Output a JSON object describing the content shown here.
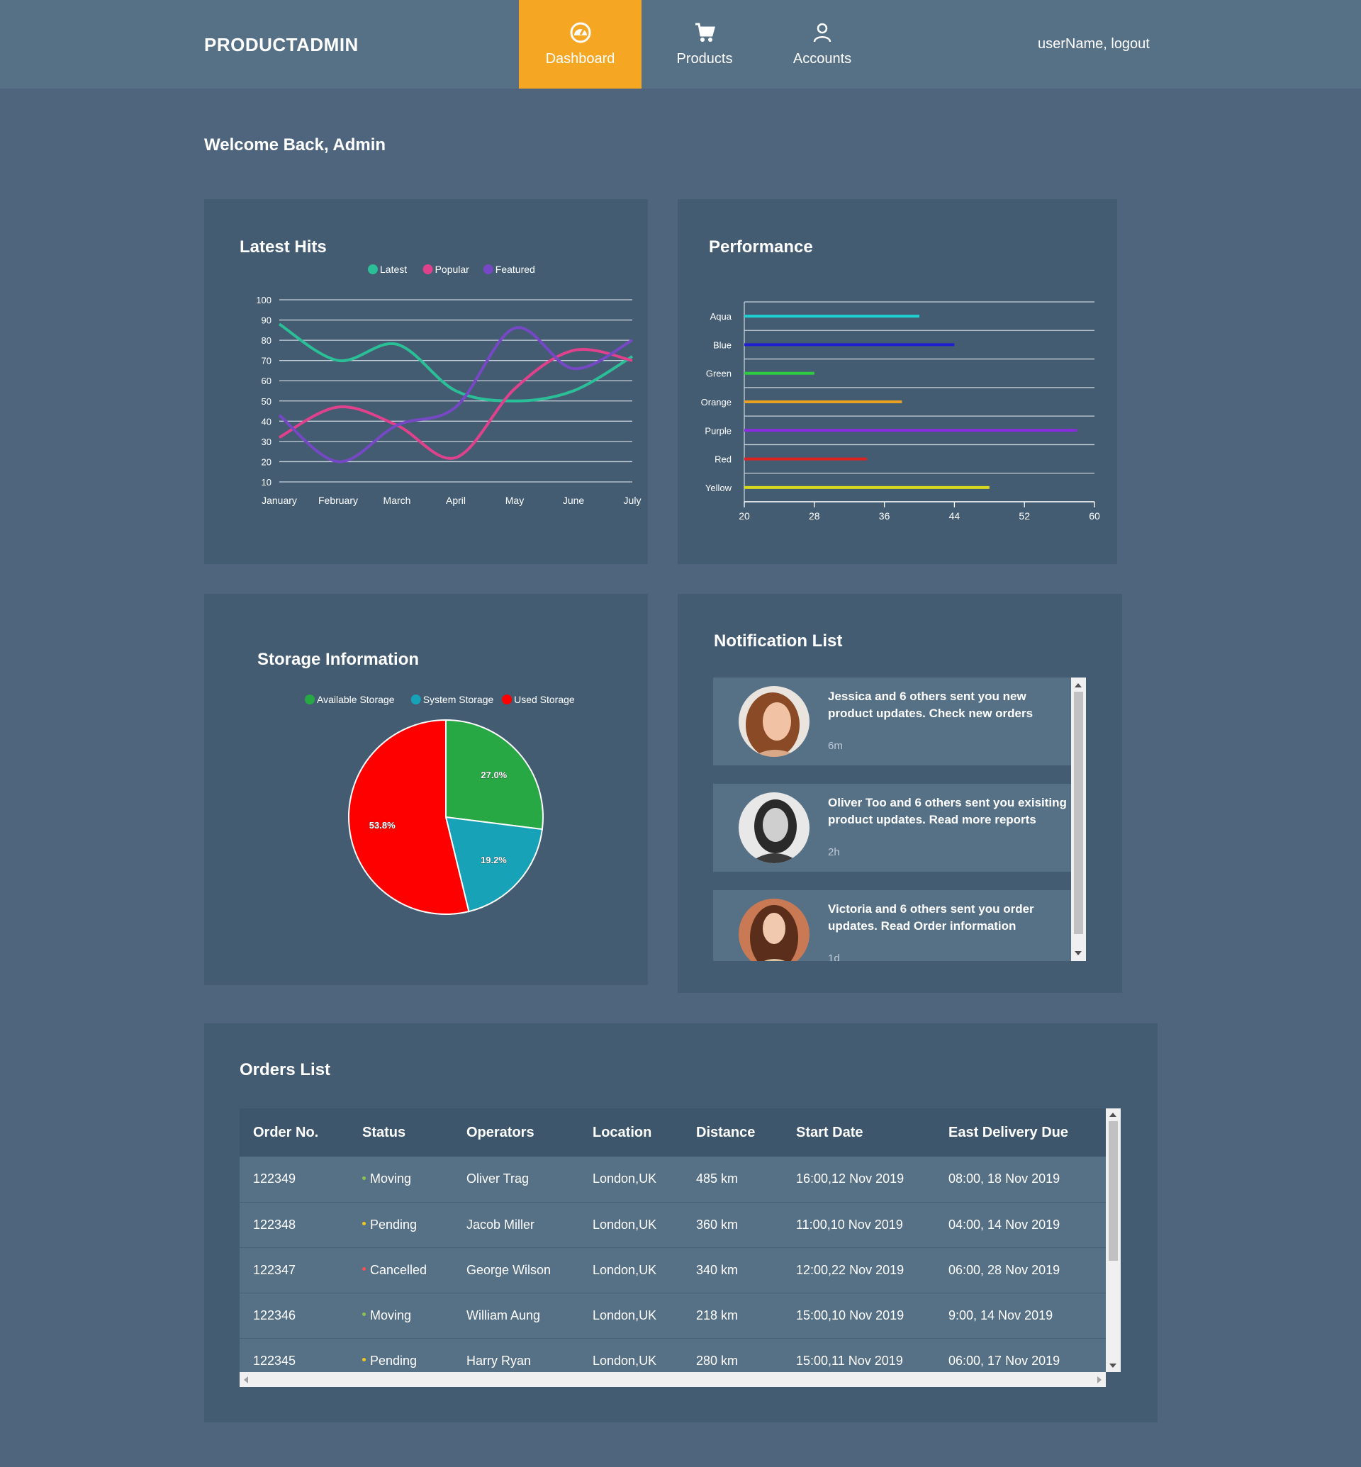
{
  "nav": {
    "brand": "PRODUCTADMIN",
    "items": [
      {
        "label": "Dashboard",
        "icon": "dashboard-gauge-icon",
        "active": true
      },
      {
        "label": "Products",
        "icon": "shopping-cart-icon",
        "active": false
      },
      {
        "label": "Accounts",
        "icon": "user-icon",
        "active": false
      }
    ],
    "user_link": "userName, logout",
    "active_color": "#f5a623"
  },
  "welcome": "Welcome Back, Admin",
  "hits": {
    "title": "Latest Hits",
    "chart_data": {
      "type": "line",
      "categories": [
        "January",
        "February",
        "March",
        "April",
        "May",
        "June",
        "July"
      ],
      "series": [
        {
          "name": "Latest",
          "color": "#2bbf98",
          "values": [
            88,
            70,
            78,
            55,
            50,
            55,
            72
          ]
        },
        {
          "name": "Popular",
          "color": "#e0418d",
          "values": [
            32,
            47,
            38,
            22,
            56,
            75,
            70
          ]
        },
        {
          "name": "Featured",
          "color": "#7648c5",
          "values": [
            43,
            20,
            38,
            47,
            86,
            66,
            80
          ]
        }
      ],
      "yticks": [
        10,
        20,
        30,
        40,
        50,
        60,
        70,
        80,
        90,
        100
      ],
      "ylim": [
        10,
        100
      ],
      "legend_position": "top",
      "grid": true
    }
  },
  "performance": {
    "title": "Performance",
    "chart_data": {
      "type": "bar",
      "orientation": "horizontal",
      "categories": [
        "Aqua",
        "Blue",
        "Green",
        "Orange",
        "Purple",
        "Red",
        "Yellow"
      ],
      "values": [
        40,
        44,
        28,
        38,
        58,
        34,
        48
      ],
      "colors": [
        "#1ed0d0",
        "#1f1fcf",
        "#2ecc40",
        "#e8a020",
        "#8a2be2",
        "#dd2222",
        "#d8d820"
      ],
      "xticks": [
        20,
        28,
        36,
        44,
        52,
        60
      ],
      "xlim": [
        20,
        60
      ],
      "grid": true
    }
  },
  "storage": {
    "title": "Storage Information",
    "chart_data": {
      "type": "pie",
      "labels": [
        "Available Storage",
        "System Storage",
        "Used Storage"
      ],
      "values": [
        27.0,
        19.2,
        53.8
      ],
      "value_labels": [
        "27.0%",
        "19.2%",
        "53.8%"
      ],
      "colors": [
        "#28a745",
        "#17a2b8",
        "#ff0000"
      ],
      "legend_position": "top"
    }
  },
  "notifications": {
    "title": "Notification List",
    "items": [
      {
        "text": "Jessica and 6 others sent you new product updates. Check new orders",
        "time": "6m"
      },
      {
        "text": "Oliver Too and 6 others sent you exisiting product updates. Read more reports",
        "time": "2h"
      },
      {
        "text": "Victoria and 6 others sent you order updates. Read Order information",
        "time": "1d"
      }
    ]
  },
  "orders": {
    "title": "Orders List",
    "columns": [
      "Order No.",
      "Status",
      "Operators",
      "Location",
      "Distance",
      "Start Date",
      "East Delivery Due"
    ],
    "status_colors": {
      "Moving": "#8bc34a",
      "Pending": "#f5c518",
      "Cancelled": "#ff4e4e"
    },
    "rows": [
      [
        "122349",
        "Moving",
        "Oliver Trag",
        "London,UK",
        "485 km",
        "16:00,12 Nov 2019",
        "08:00, 18 Nov 2019"
      ],
      [
        "122348",
        "Pending",
        "Jacob Miller",
        "London,UK",
        "360 km",
        "11:00,10 Nov 2019",
        "04:00, 14 Nov 2019"
      ],
      [
        "122347",
        "Cancelled",
        "George Wilson",
        "London,UK",
        "340 km",
        "12:00,22 Nov 2019",
        "06:00, 28 Nov 2019"
      ],
      [
        "122346",
        "Moving",
        "William Aung",
        "London,UK",
        "218 km",
        "15:00,10 Nov 2019",
        "9:00, 14 Nov 2019"
      ],
      [
        "122345",
        "Pending",
        "Harry Ryan",
        "London,UK",
        "280 km",
        "15:00,11 Nov 2019",
        "06:00, 17 Nov 2019"
      ]
    ]
  }
}
